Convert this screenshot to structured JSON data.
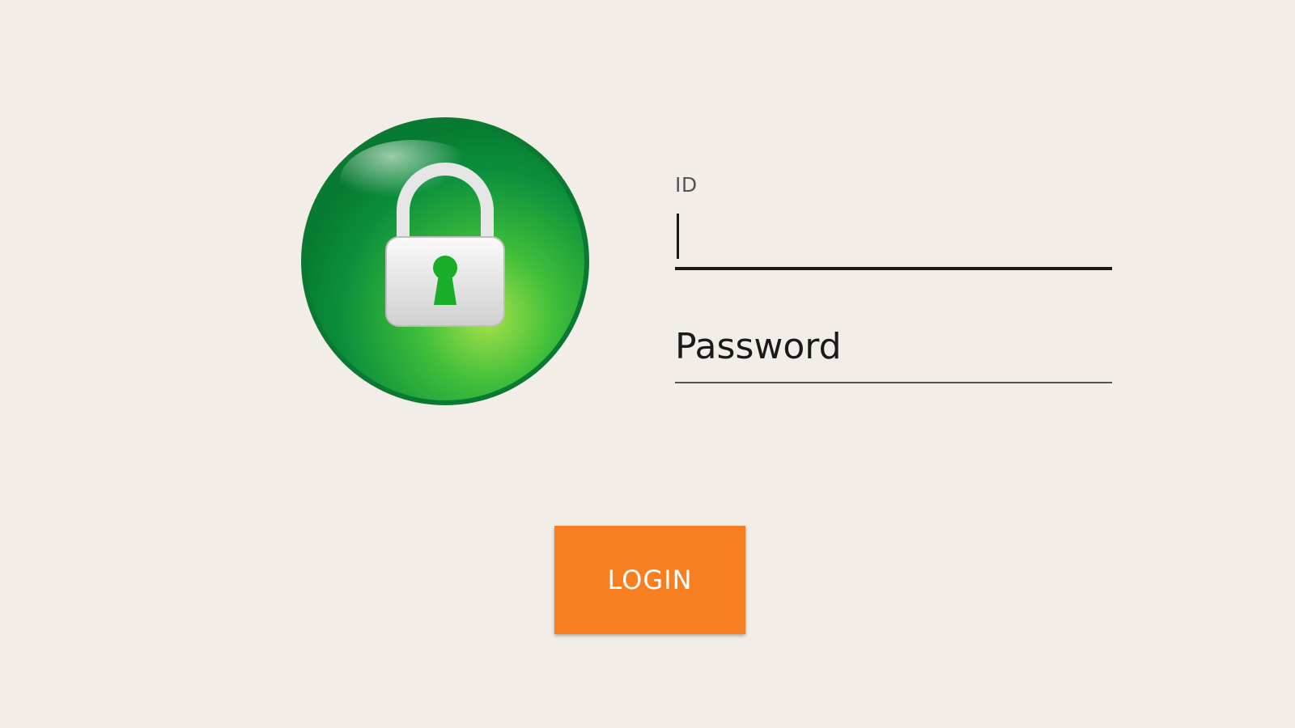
{
  "logo": {
    "icon": "lock-icon",
    "circle_color": "#0a8f3a",
    "keyhole_color": "#1aad2a"
  },
  "form": {
    "id_label": "ID",
    "id_value": "",
    "password_placeholder": "Password",
    "password_value": ""
  },
  "login": {
    "label": "LOGIN",
    "color": "#f77f1f"
  }
}
